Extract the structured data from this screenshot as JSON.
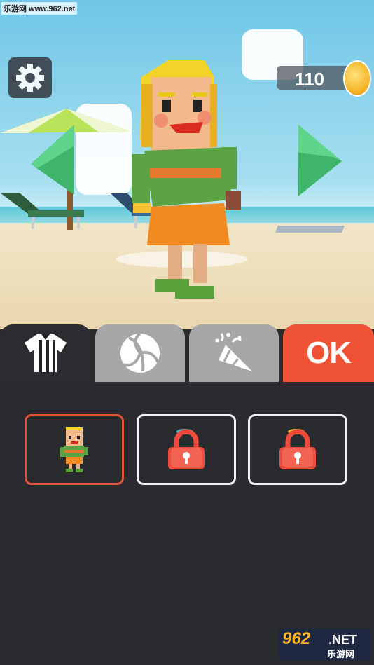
{
  "watermark": "乐游网 www.962.net",
  "hud": {
    "coin_count": "110"
  },
  "tabs": {
    "ok_label": "OK"
  },
  "icons": {
    "settings": "gear-icon",
    "coin": "coin-icon",
    "prev": "arrow-left-icon",
    "next": "arrow-right-icon",
    "outfit": "jersey-icon",
    "ball": "volleyball-icon",
    "party": "party-popper-icon",
    "lock": "padlock-icon"
  },
  "colors": {
    "ok_tab": "#ef5234",
    "selected_border": "#e0533a",
    "panel": "#2a2b2f"
  },
  "skins": [
    {
      "state": "selected"
    },
    {
      "state": "locked"
    },
    {
      "state": "locked"
    }
  ],
  "logo": {
    "number": "962",
    "net": ".NET",
    "cn": "乐游网"
  }
}
